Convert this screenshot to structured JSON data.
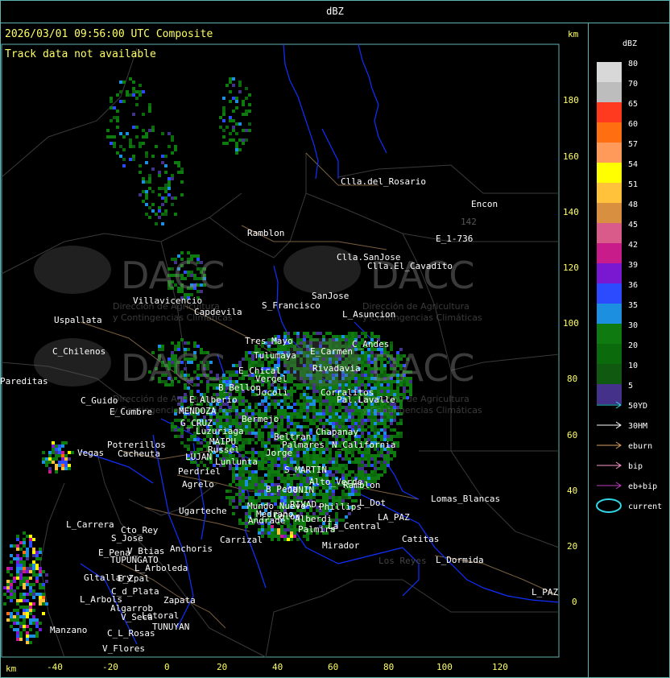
{
  "header": {
    "title": "dBZ",
    "timestamp": "2026/03/01 09:56:00 UTC Composite",
    "track_note": "Track data not available",
    "unit_top": "km",
    "unit_bottom": "km"
  },
  "axes": {
    "x_ticks": [
      "-40",
      "-20",
      "0",
      "20",
      "40",
      "60",
      "80",
      "100",
      "120"
    ],
    "y_ticks": [
      "180",
      "160",
      "140",
      "120",
      "100",
      "80",
      "60",
      "40",
      "20",
      "0"
    ]
  },
  "places": [
    "Clla.del_Rosario",
    "Encon",
    "142",
    "E_1-736",
    "Ramblon",
    "Clla.SanJose",
    "Clla.El_Cavadito",
    "Villavicencio",
    "Capdevila",
    "S_Francisco",
    "SanJose",
    "L_Asuncion",
    "Uspallata",
    "C_Chilenos",
    "Tres_Mayo",
    "Tulumaya",
    "E_Carmen",
    "C_Andes",
    "E_Chical",
    "Vergel",
    "C_Guido",
    "B_Bellon",
    "Jocoli",
    "E_Alberio",
    "Pareditas",
    "Rivadavia",
    "Corralitos",
    "MENDOZA",
    "Pal.Lavalle",
    "E_Cumbre",
    "G_CRUZ",
    "Luzuriaga",
    "Bermejo",
    "Beltran",
    "Chapanay",
    "MAIPU",
    "Russel",
    "Palmares",
    "Jorge",
    "N_California",
    "Potrerillos",
    "Cacheuta",
    "LUJAN",
    "Lunlunta",
    "S_MARTIN",
    "Perdriel",
    "Alto_Verde",
    "Ramblon",
    "Agrelo",
    "B_Pena",
    "JUNIN",
    "Ugarteche",
    "L_Carrera",
    "Cto_Rey",
    "Mundo_Nuevo",
    "Medrano",
    "RIVAD.",
    "Phillips",
    "L_Dot",
    "Lomas_Blancas",
    "S_Jose",
    "Carrizal",
    "Colon",
    "Alberdi",
    "Andrade",
    "Palmira",
    "La_Central",
    "LA_PAZ",
    "Catitas",
    "E_Pena",
    "V_Btias",
    "Anchoris",
    "TUPUNGATO",
    "Mirador",
    "L_Arboleda",
    "Gltallary",
    "E_Zpal",
    "L_Dormida",
    "C_d_Plata",
    "L_Arbols",
    "Zapata",
    "Algarrob",
    "V_Seca",
    "Lotoral",
    "TUNUYAN",
    "Manzano",
    "C_L_Rosas",
    "V_Flores",
    "L_PAZ",
    "Vegas",
    "Los Reyes"
  ],
  "watermarks": [
    {
      "logo": "DACC",
      "sub1": "Dirección de Agricultura",
      "sub2": "y Contingencias Climáticas"
    },
    {
      "logo": "DACC",
      "sub1": "Dirección de Agricultura",
      "sub2": "y Contingencias Climáticas"
    },
    {
      "logo": "DACC",
      "sub1": "Dirección de Agricultura",
      "sub2": "y Contingencias Climáticas"
    },
    {
      "logo": "DACC",
      "sub1": "Dirección de Agricultura",
      "sub2": "y Contingencias Climáticas"
    }
  ],
  "legend": {
    "title": "dBZ",
    "scale": [
      {
        "label": "80",
        "color": "#d8d8d8"
      },
      {
        "label": "70",
        "color": "#bdbdbd"
      },
      {
        "label": "65",
        "color": "#ff3a1f"
      },
      {
        "label": "60",
        "color": "#ff6e10"
      },
      {
        "label": "57",
        "color": "#ff9a5a"
      },
      {
        "label": "54",
        "color": "#ffff00"
      },
      {
        "label": "51",
        "color": "#ffc23a"
      },
      {
        "label": "48",
        "color": "#d89040"
      },
      {
        "label": "45",
        "color": "#d85b8a"
      },
      {
        "label": "42",
        "color": "#c71c8a"
      },
      {
        "label": "39",
        "color": "#7a17d0"
      },
      {
        "label": "36",
        "color": "#2c4bff"
      },
      {
        "label": "35",
        "color": "#1d8fe0"
      },
      {
        "label": "30",
        "color": "#0f7a0f"
      },
      {
        "label": "20",
        "color": "#0b6a0b"
      },
      {
        "label": "10",
        "color": "#0f5a10"
      },
      {
        "label": "5",
        "color": "#44328a"
      }
    ],
    "tracks": [
      {
        "label": "50YD",
        "color": "#33d6e6"
      },
      {
        "label": "30HM",
        "color": "#ffffff"
      },
      {
        "label": "eburn",
        "color": "#d8a060"
      },
      {
        "label": "bip",
        "color": "#ff9ad0"
      },
      {
        "label": "eb+bip",
        "color": "#c040c0"
      }
    ],
    "current": {
      "label": "current",
      "color": "#33d6e6"
    }
  },
  "colors": {
    "frame": "#5fb3b3",
    "text_axis": "#ffff66",
    "province_border": "#0a2aff",
    "road": "#8a7050",
    "contour": "#444444"
  }
}
